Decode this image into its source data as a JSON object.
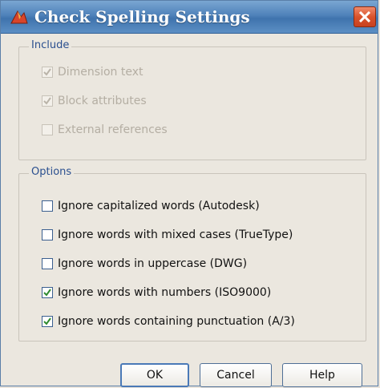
{
  "window": {
    "title": "Check Spelling Settings"
  },
  "include": {
    "label": "Include",
    "items": [
      {
        "label": "Dimension text",
        "checked": true,
        "enabled": false
      },
      {
        "label": "Block attributes",
        "checked": true,
        "enabled": false
      },
      {
        "label": "External references",
        "checked": false,
        "enabled": false
      }
    ]
  },
  "options": {
    "label": "Options",
    "items": [
      {
        "label": "Ignore capitalized words (Autodesk)",
        "checked": false,
        "enabled": true
      },
      {
        "label": "Ignore words with mixed cases (TrueType)",
        "checked": false,
        "enabled": true
      },
      {
        "label": "Ignore words in uppercase (DWG)",
        "checked": false,
        "enabled": true
      },
      {
        "label": "Ignore words with numbers (ISO9000)",
        "checked": true,
        "enabled": true
      },
      {
        "label": "Ignore words containing punctuation (A/3)",
        "checked": true,
        "enabled": true
      }
    ]
  },
  "buttons": {
    "ok": "OK",
    "cancel": "Cancel",
    "help": "Help"
  },
  "colors": {
    "titlebar": "#4f82ba",
    "group_label": "#2a4f8f",
    "close": "#d9532c"
  }
}
